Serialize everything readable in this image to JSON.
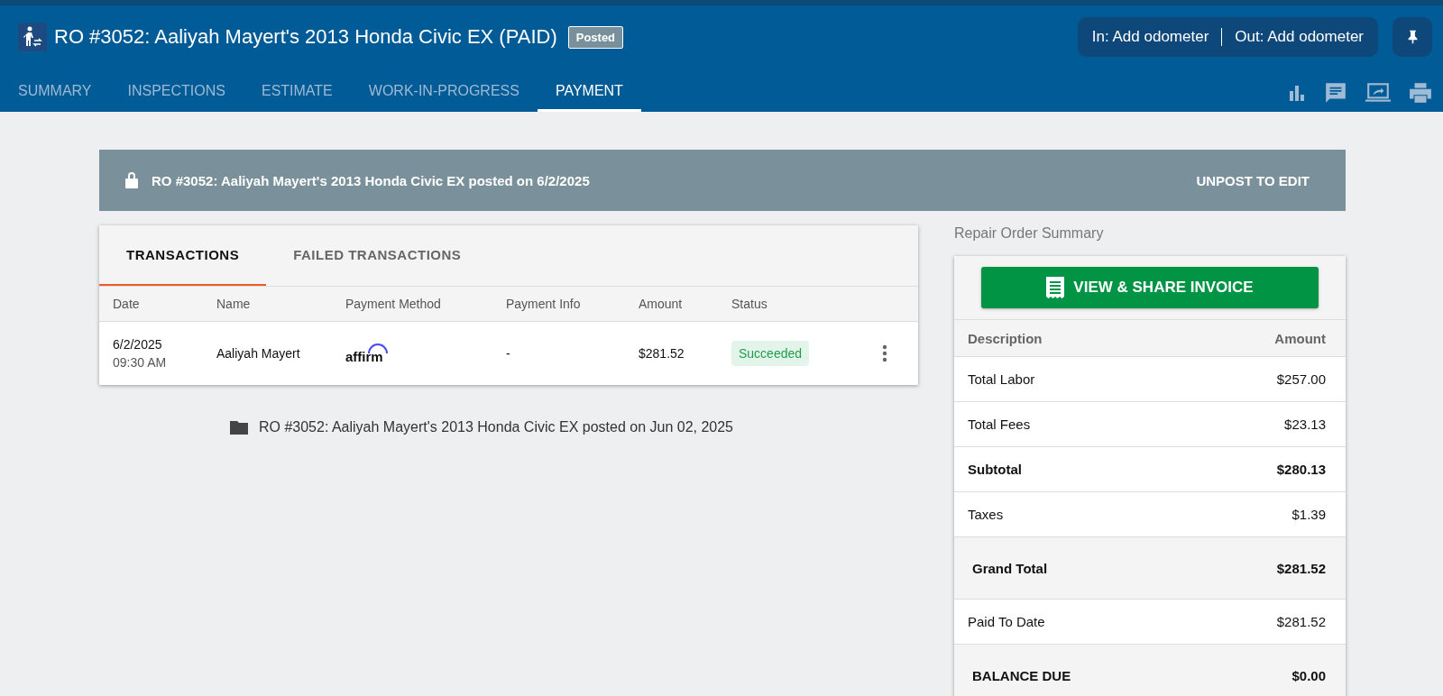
{
  "header": {
    "title": "RO #3052: Aaliyah Mayert's 2013 Honda Civic EX (PAID)",
    "badge": "Posted",
    "odometer_in": "In: Add odometer",
    "odometer_out": "Out: Add odometer"
  },
  "tabs": [
    {
      "label": "SUMMARY",
      "selected": false
    },
    {
      "label": "INSPECTIONS",
      "selected": false
    },
    {
      "label": "ESTIMATE",
      "selected": false
    },
    {
      "label": "WORK-IN-PROGRESS",
      "selected": false
    },
    {
      "label": "PAYMENT",
      "selected": true
    }
  ],
  "banner": {
    "message": "RO #3052: Aaliyah Mayert's 2013 Honda Civic EX posted on 6/2/2025",
    "action": "UNPOST TO EDIT"
  },
  "transaction_tabs": [
    {
      "label": "TRANSACTIONS",
      "selected": true
    },
    {
      "label": "FAILED TRANSACTIONS",
      "selected": false
    }
  ],
  "table": {
    "columns": [
      "Date",
      "Name",
      "Payment Method",
      "Payment Info",
      "Amount",
      "Status"
    ],
    "rows": [
      {
        "date": "6/2/2025",
        "time": "09:30 AM",
        "name": "Aaliyah Mayert",
        "payment_method": "affirm",
        "payment_info": "-",
        "amount": "$281.52",
        "status": "Succeeded",
        "kind": "success"
      }
    ]
  },
  "posted_note": "RO #3052: Aaliyah Mayert's 2013 Honda Civic EX posted on Jun 02, 2025",
  "summary": {
    "title": "Repair Order Summary",
    "button": "VIEW & SHARE INVOICE",
    "columns": [
      "Description",
      "Amount"
    ],
    "rows": [
      {
        "label": "Total Labor",
        "amount": "$257.00",
        "kind": "normal"
      },
      {
        "label": "Total Fees",
        "amount": "$23.13",
        "kind": "normal"
      },
      {
        "label": "Subtotal",
        "amount": "$280.13",
        "kind": "bold"
      },
      {
        "label": "Taxes",
        "amount": "$1.39",
        "kind": "normal"
      },
      {
        "label": "Grand Total",
        "amount": "$281.52",
        "kind": "total"
      },
      {
        "label": "Paid To Date",
        "amount": "$281.52",
        "kind": "normal"
      },
      {
        "label": "BALANCE DUE",
        "amount": "$0.00",
        "kind": "total"
      }
    ]
  }
}
